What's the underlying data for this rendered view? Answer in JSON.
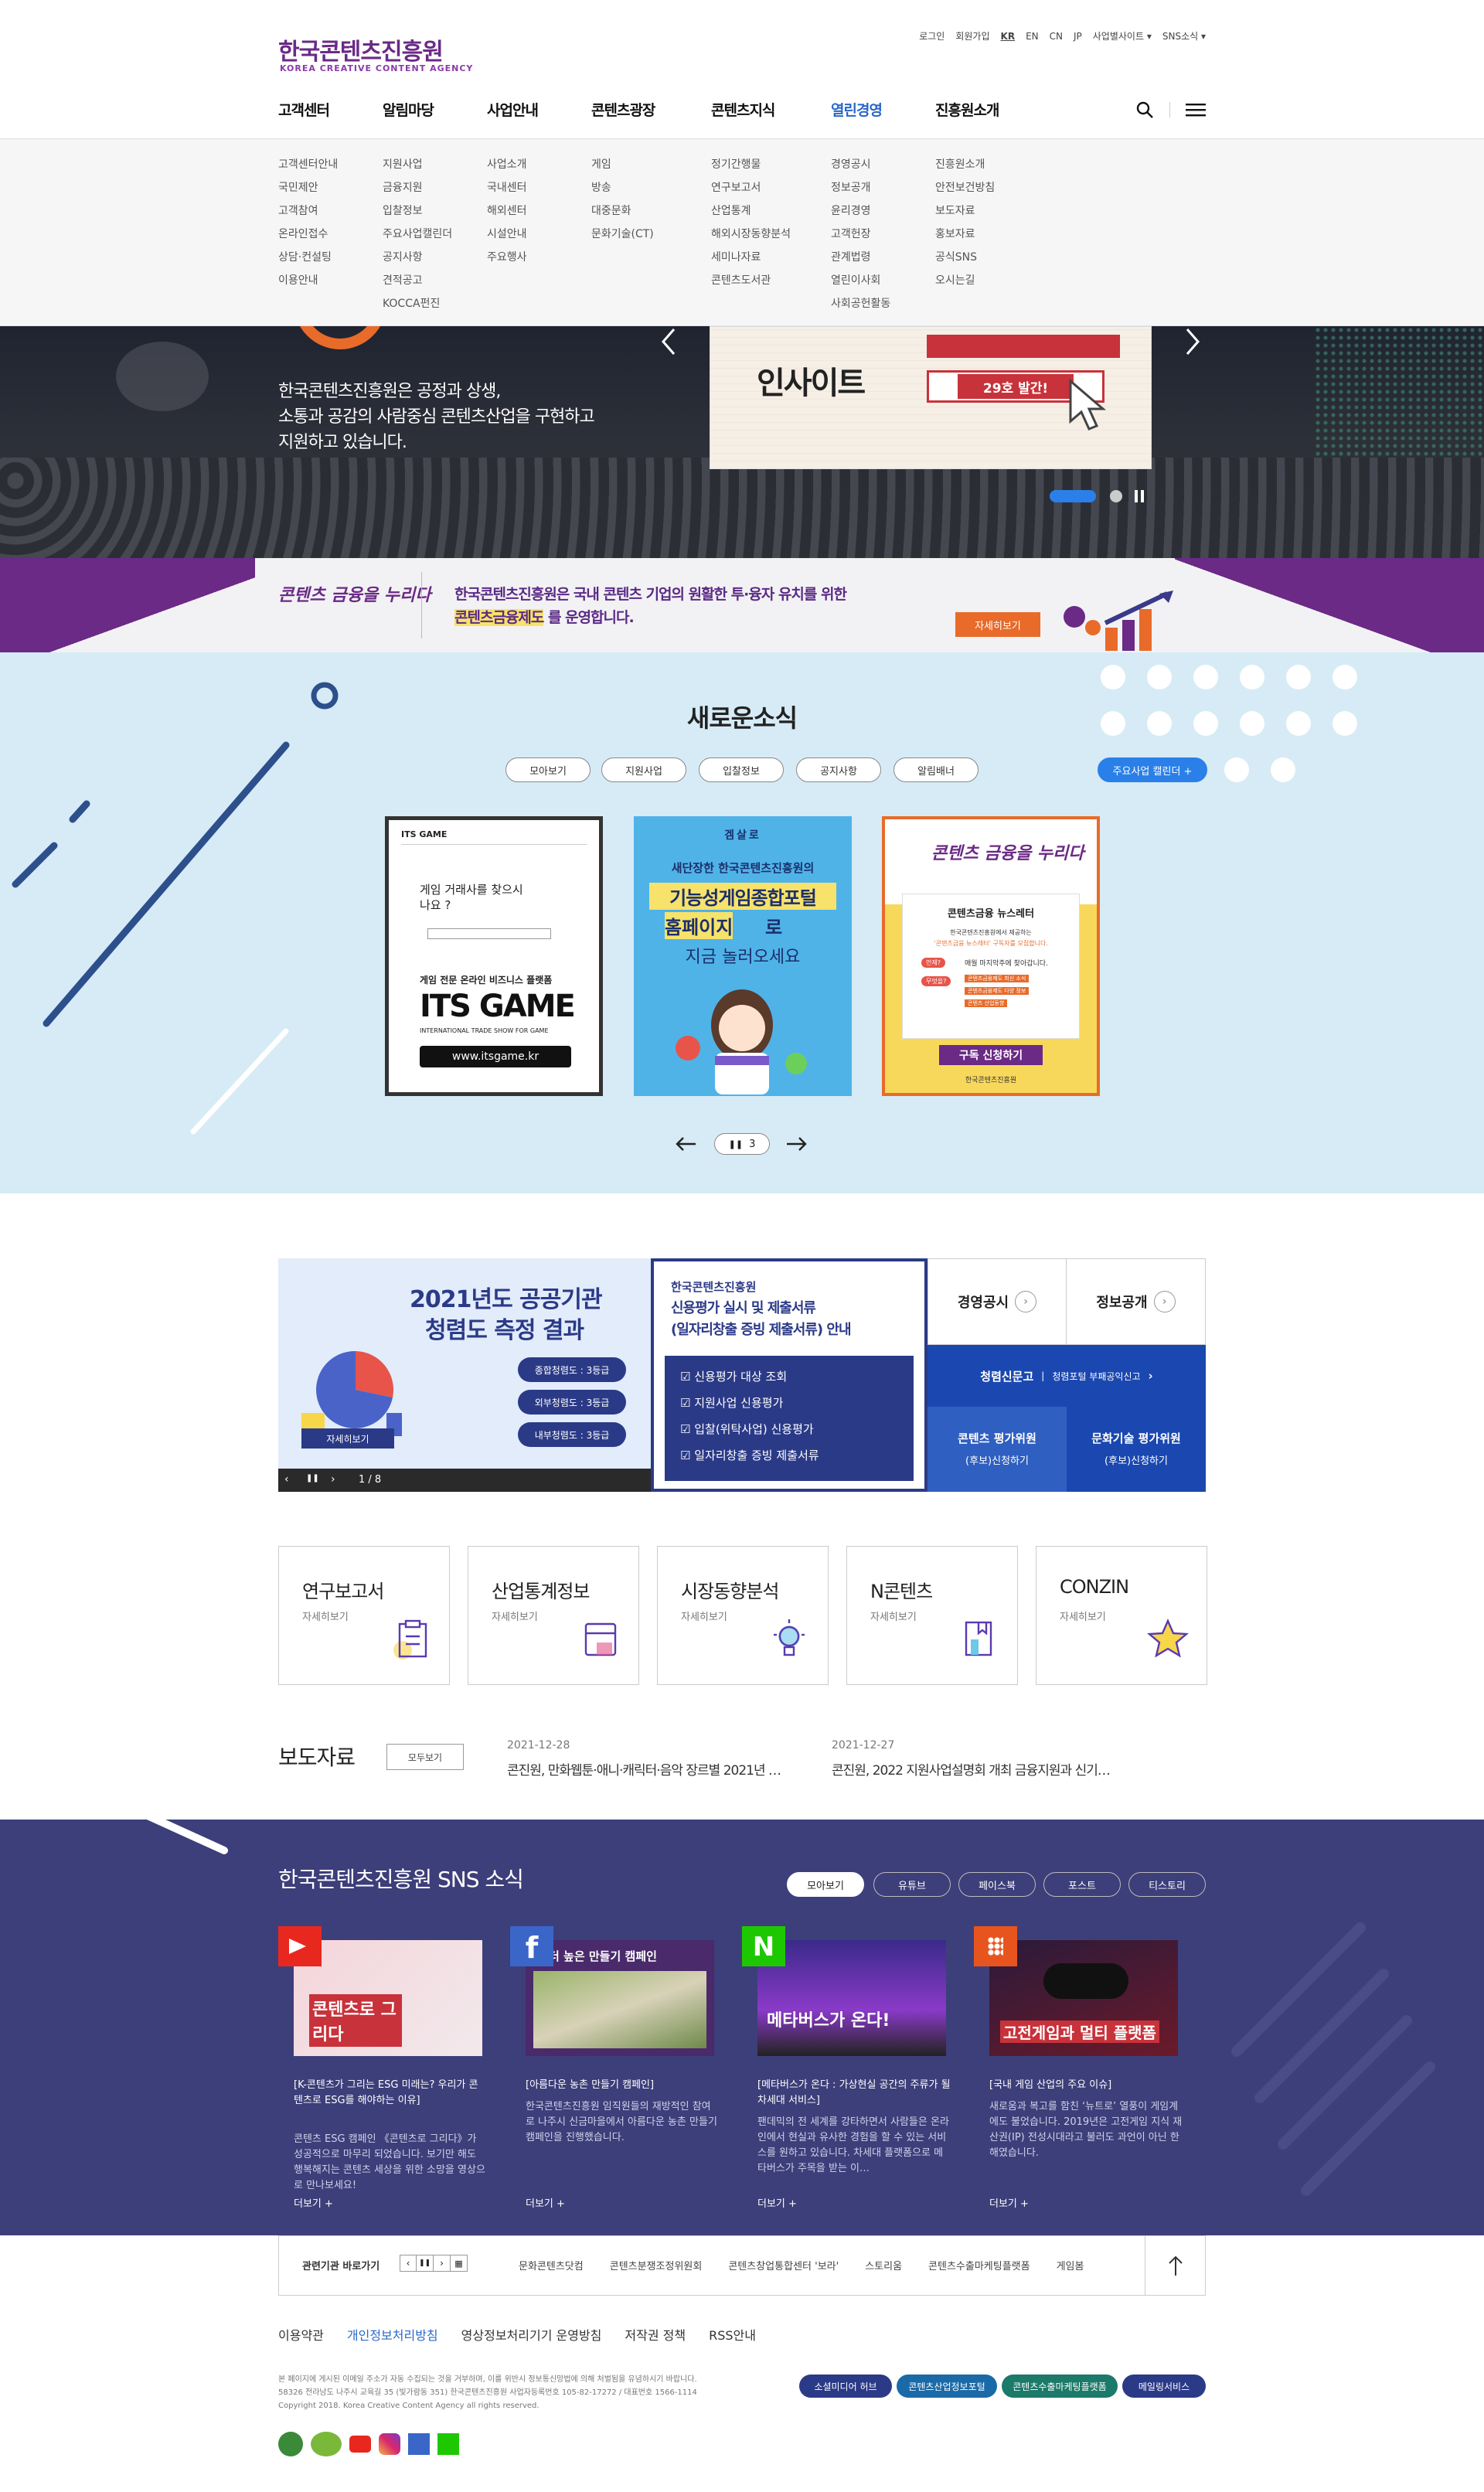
{
  "header": {
    "logo_ko": "한국콘텐츠진흥원",
    "logo_en": "KOREA CREATIVE CONTENT AGENCY",
    "util": [
      "로그인",
      "회원가입",
      "KR",
      "EN",
      "CN",
      "JP",
      "사업별사이트 ▾",
      "SNS소식 ▾"
    ],
    "gnb": [
      "고객센터",
      "알림마당",
      "사업안내",
      "콘텐츠광장",
      "콘텐츠지식",
      "열린경영",
      "진흥원소개"
    ],
    "search_icon": "search-icon",
    "menu_icon": "hamburger-icon"
  },
  "mega": [
    [
      "고객센터안내",
      "국민제안",
      "고객참여",
      "온라인접수",
      "상담·컨설팅",
      "이용안내"
    ],
    [
      "지원사업",
      "금융지원",
      "입찰정보",
      "주요사업캘린더",
      "공지사항",
      "견적공고",
      "KOCCA펀진"
    ],
    [
      "사업소개",
      "국내센터",
      "해외센터",
      "시설안내",
      "주요행사"
    ],
    [
      "게임",
      "방송",
      "대중문화",
      "문화기술(CT)"
    ],
    [
      "정기간행물",
      "연구보고서",
      "산업통계",
      "해외시장동향분석",
      "세미나자료",
      "콘텐츠도서관"
    ],
    [
      "경영공시",
      "정보공개",
      "윤리경영",
      "고객헌장",
      "관계법령",
      "열린이사회",
      "사회공헌활동"
    ],
    [
      "진흥원소개",
      "안전보건방침",
      "보도자료",
      "홍보자료",
      "공식SNS",
      "오시는길"
    ]
  ],
  "hero": {
    "text": [
      "한국콘텐츠진흥원은 공정과 상생,",
      "소통과 공감의 사람중심 콘텐츠산업을 구현하고",
      "지원하고 있습니다."
    ],
    "card_title": "인사이트",
    "card_badge": "29호 발간!",
    "prev_icon": "chevron-left-icon",
    "next_icon": "chevron-right-icon"
  },
  "fin_banner": {
    "logo": "콘텐츠 금융을 누리다",
    "line1": "한국콘텐츠진흥원은 국내 콘텐츠 기업의 원활한 투·융자 유치를 위한",
    "line2_hl": "콘텐츠금융제도",
    "line2_rest": " 를 운영합니다.",
    "button": "자세히보기"
  },
  "news": {
    "title": "새로운소식",
    "tabs": [
      "모아보기",
      "지원사업",
      "입찰정보",
      "공지사항",
      "알림배너"
    ],
    "calendar": "주요사업 캘린더 +",
    "cards": [
      {
        "top": "ITS GAME",
        "q": "게임 거래사를 찾으시나요 ?",
        "sub": "게임 전문 온라인 비즈니스 플랫폼",
        "big": "ITS GAME",
        "small": "INTERNATIONAL TRADE SHOW FOR GAME",
        "url": "www.itsgame.kr"
      },
      {
        "brand": "겜살로",
        "l1": "새단장한 한국콘텐츠진흥원의",
        "l2": "기능성게임종합포털",
        "l3": "홈페이지",
        "l4": "로",
        "l5": "지금 놀러오세요"
      },
      {
        "logo": "콘텐츠 금융을 누리다",
        "box": "콘텐츠금융 뉴스레터",
        "d1": "한국콘텐츠진흥원에서 제공하는",
        "d2": "‘콘텐츠금융 뉴스레터’ 구독자를 모집합니다.",
        "r1": "언제?",
        "r2": "무엇을?",
        "b1": "매월 마지막주에 찾아갑니다.",
        "b2": "콘텐츠금융제도 최신 소식",
        "b3": "콘텐츠금융제도 다양 정보",
        "b4": "콘텐츠 산업동향",
        "cta": "구독 신청하기",
        "foot": "한국콘텐츠진흥원"
      }
    ],
    "pager": "3"
  },
  "board": {
    "slide_title1": "2021년도 공공기관",
    "slide_title2": "청렴도 측정 결과",
    "grades": [
      "종합청렴도 : 3등급",
      "외부청렴도 : 3등급",
      "내부청렴도 : 3등급"
    ],
    "detail": "자세히보기",
    "counter": "1 / 8",
    "notice_org": "한국콘텐츠진흥원",
    "notice_t1": "신용평가 실시 및 제출서류",
    "notice_t2": "(일자리창출 증빙 제출서류) 안내",
    "checks": [
      "신용평가 대상 조회",
      "지원사업 신용평가",
      "입찰(위탁사업) 신용평가",
      "일자리창출 증빙 제출서류"
    ],
    "link1": "경영공시",
    "link2": "정보공개",
    "blue1a": "청렴신문고",
    "blue1b": "청렴포털 부패공익신고",
    "blue2a": "콘텐츠 평가위원",
    "blue2b": "(후보)신청하기",
    "blue3a": "문화기술 평가위원",
    "blue3b": "(후보)신청하기"
  },
  "quick": [
    {
      "t": "연구보고서",
      "m": "자세히보기",
      "icon": "clipboard-icon"
    },
    {
      "t": "산업통계정보",
      "m": "자세히보기",
      "icon": "chart-folder-icon"
    },
    {
      "t": "시장동향분석",
      "m": "자세히보기",
      "icon": "lightbulb-icon"
    },
    {
      "t": "N콘텐츠",
      "m": "자세히보기",
      "icon": "book-icon"
    },
    {
      "t": "CONZIN",
      "m": "자세히보기",
      "icon": "star-icon"
    }
  ],
  "press": {
    "title": "보도자료",
    "more": "모두보기",
    "items": [
      {
        "date": "2021-12-28",
        "text": "콘진원, 만화웹툰·애니·캐릭터·음악 장르별 2021년 …"
      },
      {
        "date": "2021-12-27",
        "text": "콘진원, 2022 지원사업설명회 개최 금융지원과 신기…"
      }
    ]
  },
  "sns": {
    "title": "한국콘텐츠진흥원 SNS 소식",
    "tabs": [
      "모아보기",
      "유튜브",
      "페이스북",
      "포스트",
      "티스토리"
    ],
    "cards": [
      {
        "label": "콘텐츠로 그리다",
        "title": "[K-콘텐츠가 그리는 ESG 미래는? 우리가 콘텐츠로 ESG를 해야하는 이유]",
        "desc": "콘텐츠 ESG 캠페인 《콘텐츠로 그리다》가 성공적으로 마무리 되었습니다. 보기만 해도 행복해지는 콘텐츠 세상을 위한 소망을 영상으로 만나보세요!",
        "more": "더보기 +"
      },
      {
        "label": "더 높은 만들기 캠페인",
        "title": "[아름다운 농촌 만들기 캠페인]",
        "desc": "한국콘텐츠진흥원 임직원들의 재방적인 참여로 나주시 신금마을에서 아름다운 농촌 만들기 캠페인을 진행했습니다.",
        "more": "더보기 +"
      },
      {
        "label": "메타버스가 온다!",
        "title": "[메타버스가 온다 : 가상현실 공간의 주류가 될 차세대 서비스]",
        "desc": "팬데믹의 전 세계를 강타하면서 사람들은 온라인에서 현실과 유사한 경험을 할 수 있는 서비스를 원하고 있습니다. 차세대 플랫폼으로 메타버스가 주목을 받는 이…",
        "more": "더보기 +"
      },
      {
        "label": "고전게임과 멀티 플랫폼",
        "title": "[국내 게임 산업의 주요 이슈]",
        "desc": "새로움과 복고를 함친 ‘뉴트로’ 열풍이 게임계에도 불었습니다. 2019년은 고전게임 지식 재산권(IP) 전성시대라고 불러도 과언이 아닌 한 해였습니다.",
        "more": "더보기 +"
      }
    ]
  },
  "footer": {
    "related": "관련기관 바로가기",
    "links": [
      "문화콘텐츠닷컴",
      "콘텐츠분쟁조정위원회",
      "콘텐츠창업통합센터 '보라'",
      "스토리움",
      "콘텐츠수출마케팅플랫폼",
      "게임봄"
    ],
    "menu": [
      "이용약관",
      "개인정보처리방침",
      "영상정보처리기기 운영방침",
      "저작권 정책",
      "RSS안내"
    ],
    "addr1": "본 페이지에 게시된 이메일 주소가 자동 수집되는 것을 거부하며, 이를 위반시 정보통신망법에 의해 처벌됨을 유념하시기 바랍니다.",
    "addr2": "58326 전라남도 나주시 교육길 35 (빛가람동 351) 한국콘텐츠진흥원 사업자등록번호 105-82-17272 / 대표번호 1566-1114",
    "addr3": "Copyright 2018. Korea Creative Content Agency all rights reserved.",
    "buttons": [
      "소셜미디어 허브",
      "콘텐츠산업정보포털",
      "콘텐츠수출마케팅플랫폼",
      "메일링서비스"
    ]
  }
}
